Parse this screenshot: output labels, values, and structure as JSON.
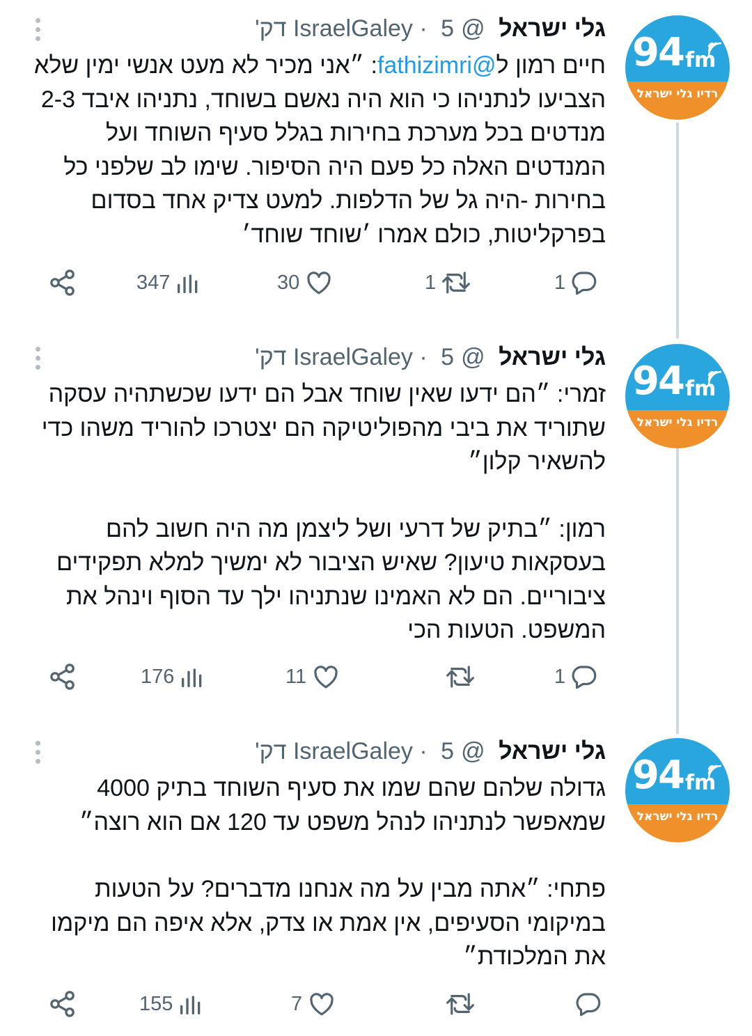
{
  "tweets": [
    {
      "author": {
        "name": "גלי ישראל",
        "handle": "@IsraelGaley",
        "time": "5 דק'",
        "separator": "·"
      },
      "avatar": {
        "big": "94",
        "small": "fm",
        "subtitle": "רדיו גלי ישראל",
        "top_color": "#2aa6de",
        "bottom_color": "#f0902a"
      },
      "text_parts": {
        "before_mention": "חיים רמון ל",
        "mention": "@fathizimri",
        "after_mention": ": ״אני מכיר לא מעט אנשי ימין שלא הצביעו לנתניהו כי הוא היה נאשם בשוחד, נתניהו איבד 2-3 מנדטים בכל מערכת בחירות בגלל סעיף השוחד ועל המנדטים האלה כל פעם היה הסיפור. שימו לב שלפני כל בחירות -היה גל של הדלפות. למעט צדיק אחד בסדום בפרקליטות, כולם אמרו ׳שוחד שוחד׳"
      },
      "stats": {
        "replies": "1",
        "retweets": "1",
        "likes": "30",
        "views": "347"
      }
    },
    {
      "author": {
        "name": "גלי ישראל",
        "handle": "@IsraelGaley",
        "time": "5 דק'",
        "separator": "·"
      },
      "avatar": {
        "big": "94",
        "small": "fm",
        "subtitle": "רדיו גלי ישראל",
        "top_color": "#2aa6de",
        "bottom_color": "#f0902a"
      },
      "paragraphs": [
        "זמרי: ״הם ידעו שאין שוחד אבל הם ידעו שכשתהיה עסקה שתוריד את ביבי מהפוליטיקה הם יצטרכו להוריד משהו כדי להשאיר קלון״",
        "רמון: ״בתיק של דרעי ושל ליצמן מה היה חשוב להם בעסקאות טיעון? שאיש הציבור לא ימשיך למלא תפקידים ציבוריים. הם לא האמינו שנתניהו ילך עד הסוף וינהל את המשפט. הטעות הכי"
      ],
      "stats": {
        "replies": "1",
        "retweets": "",
        "likes": "11",
        "views": "176"
      }
    },
    {
      "author": {
        "name": "גלי ישראל",
        "handle": "@IsraelGaley",
        "time": "5 דק'",
        "separator": "·"
      },
      "avatar": {
        "big": "94",
        "small": "fm",
        "subtitle": "רדיו גלי ישראל",
        "top_color": "#2aa6de",
        "bottom_color": "#f0902a"
      },
      "paragraphs": [
        "גדולה שלהם שהם שמו את סעיף השוחד בתיק 4000 שמאפשר לנתניהו לנהל משפט עד 120 אם הוא רוצה״",
        "פתחי: ״אתה מבין על מה אנחנו מדברים? על הטעות במיקומי הסעיפים, אין אמת או צדק, אלא איפה הם מיקמו את המלכודת״"
      ],
      "stats": {
        "replies": "",
        "retweets": "",
        "likes": "7",
        "views": "155"
      }
    }
  ],
  "icons": [
    "more-vertical-icon",
    "reply-icon",
    "retweet-icon",
    "like-icon",
    "views-icon",
    "share-icon"
  ],
  "colors": {
    "text": "#0f1419",
    "secondary": "#536471",
    "link": "#1d9bf0",
    "thread_line": "#cfd9de"
  }
}
